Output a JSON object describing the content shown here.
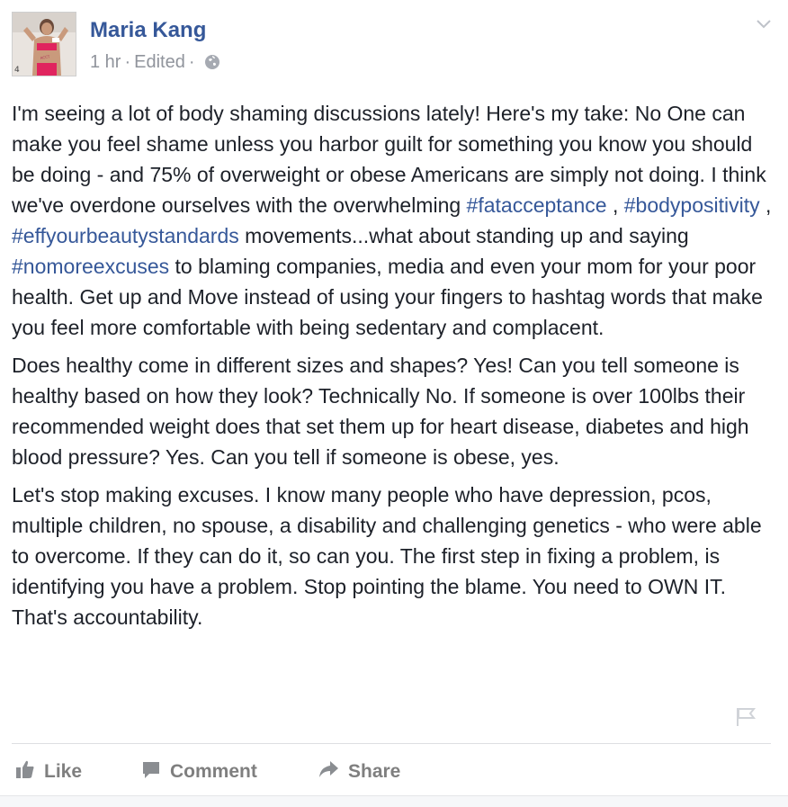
{
  "post": {
    "author": "Maria Kang",
    "time": "1 hr",
    "edited": "Edited",
    "dot": "·",
    "privacy_icon": "globe-icon",
    "menu_icon": "chevron-down-icon"
  },
  "content": {
    "p1_a": "I'm seeing a lot of body shaming discussions lately! Here's my take: No One can make you feel shame unless you harbor guilt for something you know you should be doing - and 75% of overweight or obese Americans are simply not doing. I think we've overdone ourselves with the overwhelming ",
    "tag1": "#fatacceptance",
    "sep1": " , ",
    "tag2": "#bodypositivity",
    "sep2": " , ",
    "tag3": "#effyourbeautystandards",
    "p1_b": " movements...what about standing up and saying ",
    "tag4": "#nomoreexcuses",
    "p1_c": " to blaming companies, media and even your mom for your poor health. Get up and Move instead of using your fingers to hashtag words that make you feel more comfortable with being sedentary and complacent.",
    "p2": "Does healthy come in different sizes and shapes? Yes! Can you tell someone is healthy based on how they look? Technically No. If someone is over 100lbs their recommended weight does that set them up for heart disease, diabetes and high blood pressure? Yes. Can you tell if someone is obese, yes.",
    "p3": "Let's stop making excuses. I know many people who have depression, pcos, multiple children, no spouse, a disability and challenging genetics - who were able to overcome. If they can do it, so can you. The first step in fixing a problem, is identifying you have a problem. Stop pointing the blame. You need to OWN IT. That's accountability."
  },
  "actions": {
    "like": "Like",
    "comment": "Comment",
    "share": "Share",
    "like_icon": "thumbs-up-icon",
    "comment_icon": "comment-icon",
    "share_icon": "share-arrow-icon",
    "report_icon": "flag-icon"
  },
  "colors": {
    "link": "#365899",
    "meta": "#90949c",
    "text": "#1d2129",
    "action": "#7f7f7f"
  }
}
